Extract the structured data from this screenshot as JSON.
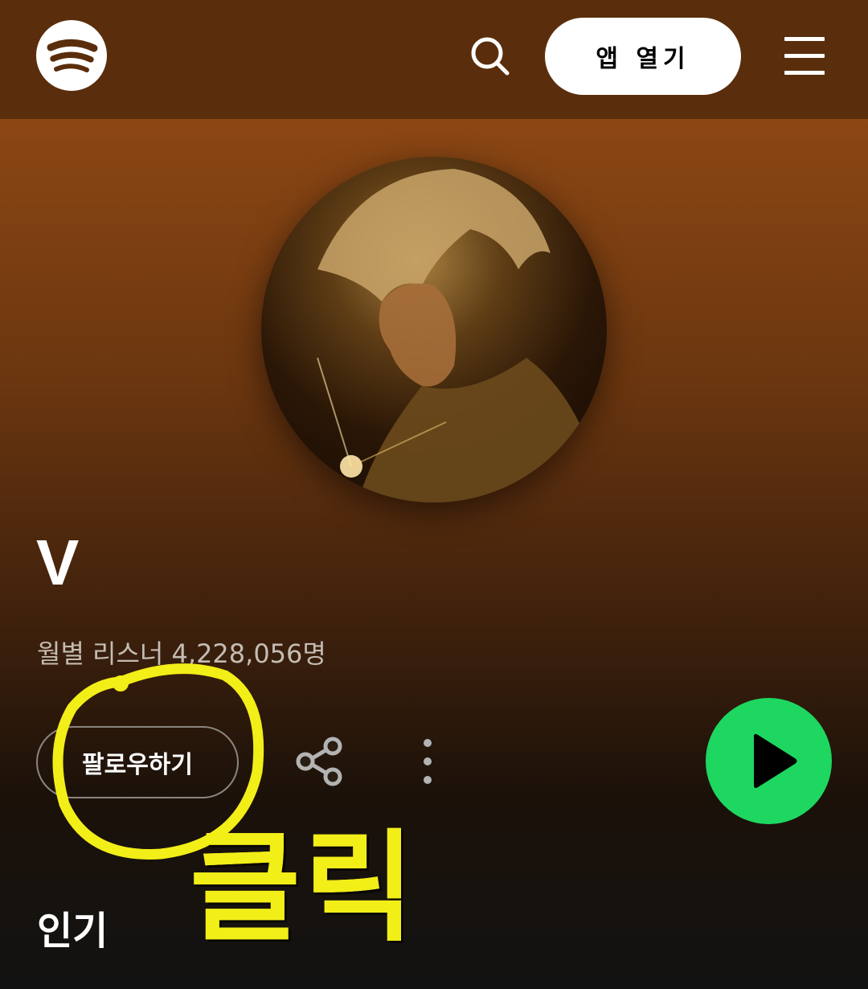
{
  "header": {
    "logo_icon": "spotify-logo-icon",
    "search_icon": "search-icon",
    "open_app_label": "앱 열기",
    "menu_icon": "hamburger-menu-icon"
  },
  "artist": {
    "name": "V",
    "monthly_listeners": "월별 리스너 4,228,056명",
    "image_icon": "artist-portrait"
  },
  "actions": {
    "follow_label": "팔로우하기",
    "share_icon": "share-icon",
    "more_icon": "more-vertical-icon",
    "play_icon": "play-icon"
  },
  "annotation": {
    "text": "클릭",
    "color": "#f2ee18"
  },
  "sections": {
    "popular_title": "인기"
  },
  "colors": {
    "header_bg": "#5a2e0c",
    "accent_green": "#1ed760"
  }
}
